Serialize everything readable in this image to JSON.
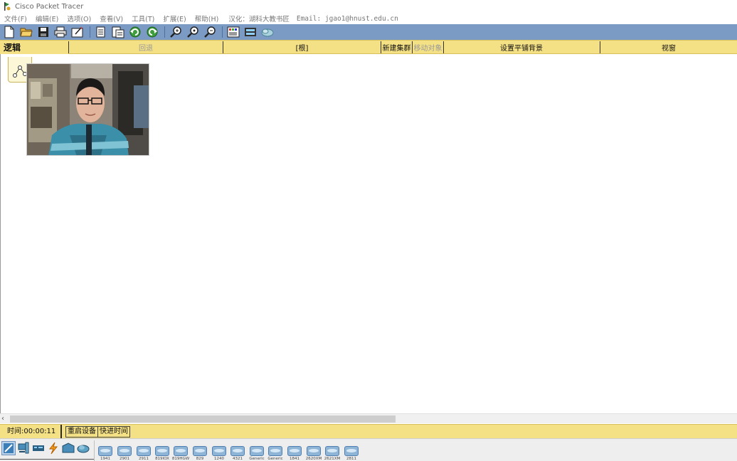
{
  "app": {
    "title": "Cisco Packet Tracer"
  },
  "menu": {
    "items": [
      "文件(F)",
      "编辑(E)",
      "选项(O)",
      "查看(V)",
      "工具(T)",
      "扩展(E)",
      "帮助(H)"
    ],
    "credit": "汉化：湖科大教书匠",
    "email": "Email: jgao1@hnust.edu.cn"
  },
  "toolbar": {
    "icons": [
      "new-file-icon",
      "open-folder-icon",
      "save-icon",
      "print-icon",
      "activity-wizard-icon",
      "copy-icon",
      "paste-icon",
      "undo-icon",
      "redo-icon",
      "zoom-in-icon",
      "zoom-reset-icon",
      "zoom-out-icon",
      "palette-icon",
      "custom-device-icon",
      "cluster-icon"
    ],
    "accent": "#7b9bc5"
  },
  "logic_bar": {
    "tab_label": "逻辑",
    "back": "回退",
    "root": "[根]",
    "new_cluster": "新建集群",
    "move_object": "移动对象",
    "set_tiled_bg": "设置平铺背景",
    "viewport": "视窗",
    "color": "#f5e185"
  },
  "status_bar": {
    "time": "时间:00:00:11",
    "power_cycle": "重启设备",
    "fast_forward": "快进时间"
  },
  "device_categories": [
    "network-devices-icon",
    "end-devices-icon",
    "components-icon",
    "connections-icon",
    "miscellaneous-icon",
    "multiuser-icon"
  ],
  "devices": [
    "1941",
    "2901",
    "2911",
    "819IOX",
    "819HGW",
    "829",
    "1240",
    "4321",
    "Generic",
    "Generic",
    "1841",
    "2620XM",
    "2621XM",
    "2811"
  ]
}
